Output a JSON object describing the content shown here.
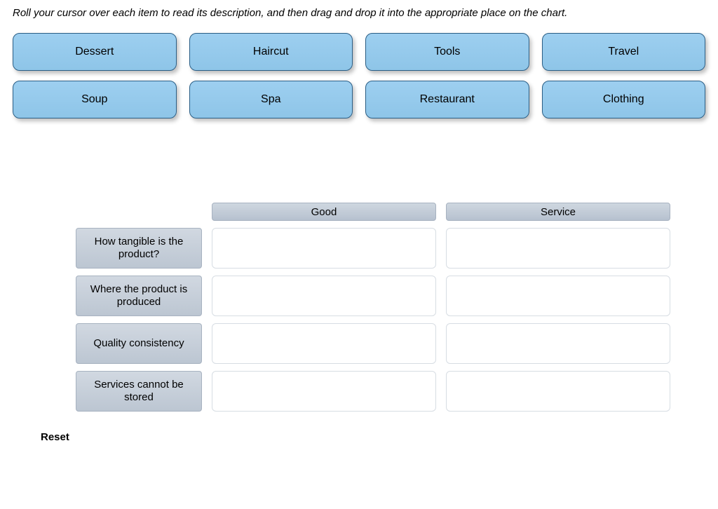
{
  "instruction": "Roll your cursor over each item to read its description, and then drag and drop it into the appropriate place on the chart.",
  "items": [
    "Dessert",
    "Haircut",
    "Tools",
    "Travel",
    "Soup",
    "Spa",
    "Restaurant",
    "Clothing"
  ],
  "columns": [
    "Good",
    "Service"
  ],
  "rows": [
    "How tangible is the product?",
    "Where the product is produced",
    "Quality consistency",
    "Services cannot be stored"
  ],
  "reset_label": "Reset"
}
